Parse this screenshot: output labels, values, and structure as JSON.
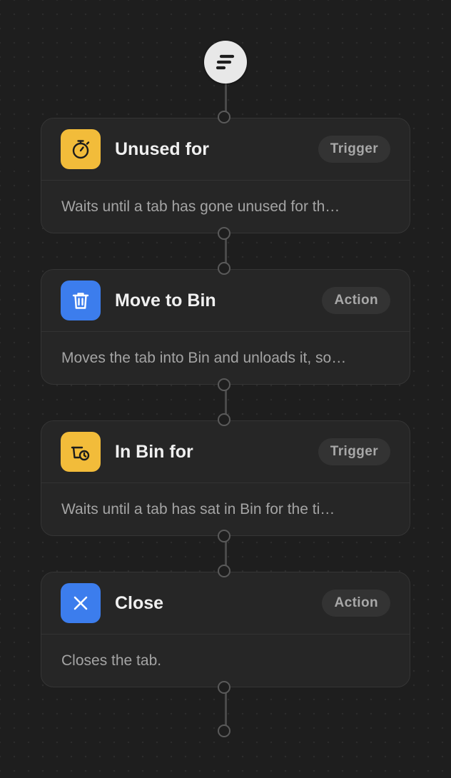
{
  "start": {
    "icon": "flow-start-icon"
  },
  "steps": [
    {
      "title": "Unused for",
      "badge": "Trigger",
      "description": "Waits until a tab has gone unused for th…",
      "icon": "stopwatch-icon",
      "icon_color": "#f2bc3a"
    },
    {
      "title": "Move to Bin",
      "badge": "Action",
      "description": "Moves the tab into Bin and unloads it, so…",
      "icon": "trash-icon",
      "icon_color": "#3c7ded"
    },
    {
      "title": "In Bin for",
      "badge": "Trigger",
      "description": "Waits until a tab has sat in Bin for the ti…",
      "icon": "bin-clock-icon",
      "icon_color": "#f2bc3a"
    },
    {
      "title": "Close",
      "badge": "Action",
      "description": "Closes the tab.",
      "icon": "close-icon",
      "icon_color": "#3c7ded"
    }
  ]
}
